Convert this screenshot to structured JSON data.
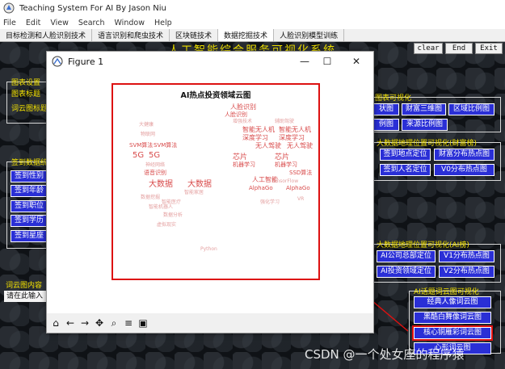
{
  "app": {
    "title": "Teaching System For AI By Jason Niu"
  },
  "menu": [
    "File",
    "Edit",
    "View",
    "Search",
    "Window",
    "Help"
  ],
  "tabs": [
    {
      "label": "目标检测和人脸识别技术",
      "active": false
    },
    {
      "label": "语言识别和爬虫技术",
      "active": false
    },
    {
      "label": "区块链技术",
      "active": false
    },
    {
      "label": "数据挖掘技术",
      "active": true
    },
    {
      "label": "人脸识别模型训练",
      "active": false
    }
  ],
  "headline": "人工智能综合服务可视化系统",
  "controls": {
    "clear": "clear",
    "end": "End",
    "exit": "Exit"
  },
  "left_panel": {
    "chart_settings_label": "图表设置",
    "chart_title_label": "图表标题",
    "wordcloud_title_label": "词云图标题",
    "checkin_label": "签到数据统计",
    "checkin_buttons": [
      "签到性别",
      "签到年龄",
      "签到职位",
      "签到学历",
      "签到星座"
    ],
    "wordcloud_content_label": "词云图内容",
    "input_placeholder": "请在此输入"
  },
  "right_panel": {
    "chart_viz_label": "图表可视化",
    "chart_buttons": [
      "状图",
      "财富三维图",
      "区域比例图",
      "例图",
      "来源比例图"
    ],
    "geo_wealth_label": "大数据地理位置可视化(财富榜)",
    "geo_wealth_buttons": [
      "签到地点定位",
      "财富分布热点图",
      "签到人名定位",
      "V0分布热点图"
    ],
    "geo_ai_label": "大数据地理位置可视化(AI榜)",
    "geo_ai_buttons": [
      "AI公司总部定位",
      "V1分布热点图",
      "AI投资领域定位",
      "V2分布热点图"
    ],
    "topic_cloud_label": "AI话题词云图可视化",
    "topic_cloud_buttons": [
      "经典人像词云图",
      "黑酷白舞像词云图",
      "核心铜雁彩词云图",
      "心形词云图"
    ]
  },
  "figure": {
    "window_title": "Figure 1",
    "chart_title": "AI热点投资领域云图",
    "words": [
      {
        "t": "人脸识别",
        "s": 8
      },
      {
        "t": "人脸识别",
        "s": 7
      },
      {
        "t": "增强技术",
        "s": 6
      },
      {
        "t": "辅助驾驶",
        "s": 6
      },
      {
        "t": "智能无人机",
        "s": 8
      },
      {
        "t": "智能无人机",
        "s": 8
      },
      {
        "t": "深度学习",
        "s": 8
      },
      {
        "t": "深度学习",
        "s": 8
      },
      {
        "t": "无人驾驶",
        "s": 8
      },
      {
        "t": "无人驾驶",
        "s": 8
      },
      {
        "t": "芯片",
        "s": 9
      },
      {
        "t": "芯片",
        "s": 9
      },
      {
        "t": "机器学习",
        "s": 7
      },
      {
        "t": "机器学习",
        "s": 7
      },
      {
        "t": "SSD算法",
        "s": 7
      },
      {
        "t": "人工智能",
        "s": 8
      },
      {
        "t": "大数据",
        "s": 10
      },
      {
        "t": "大数据",
        "s": 10
      },
      {
        "t": "5G",
        "s": 10
      },
      {
        "t": "5G",
        "s": 10
      },
      {
        "t": "SVM算法",
        "s": 7
      },
      {
        "t": "SVM算法",
        "s": 7
      },
      {
        "t": "语音识别",
        "s": 7
      },
      {
        "t": "AlphaGo",
        "s": 7
      },
      {
        "t": "AlphaGo",
        "s": 7
      },
      {
        "t": "强化学习",
        "s": 6
      },
      {
        "t": "数据挖掘",
        "s": 6
      },
      {
        "t": "智能医疗",
        "s": 6
      },
      {
        "t": "智能家居",
        "s": 6
      },
      {
        "t": "数据分析",
        "s": 6
      },
      {
        "t": "智能机器人",
        "s": 6
      },
      {
        "t": "虚拟现实",
        "s": 6
      },
      {
        "t": "Python",
        "s": 6
      },
      {
        "t": "TensorFlow",
        "s": 6
      },
      {
        "t": "VR",
        "s": 6
      },
      {
        "t": "大健康",
        "s": 6
      },
      {
        "t": "物联网",
        "s": 6
      },
      {
        "t": "神经网络",
        "s": 6
      }
    ]
  },
  "toolbar_icons": [
    "home-icon",
    "back-arrow-icon",
    "forward-arrow-icon",
    "pan-icon",
    "zoom-icon",
    "configure-icon",
    "save-icon"
  ],
  "watermark": "CSDN @一个处女座的程序猿"
}
